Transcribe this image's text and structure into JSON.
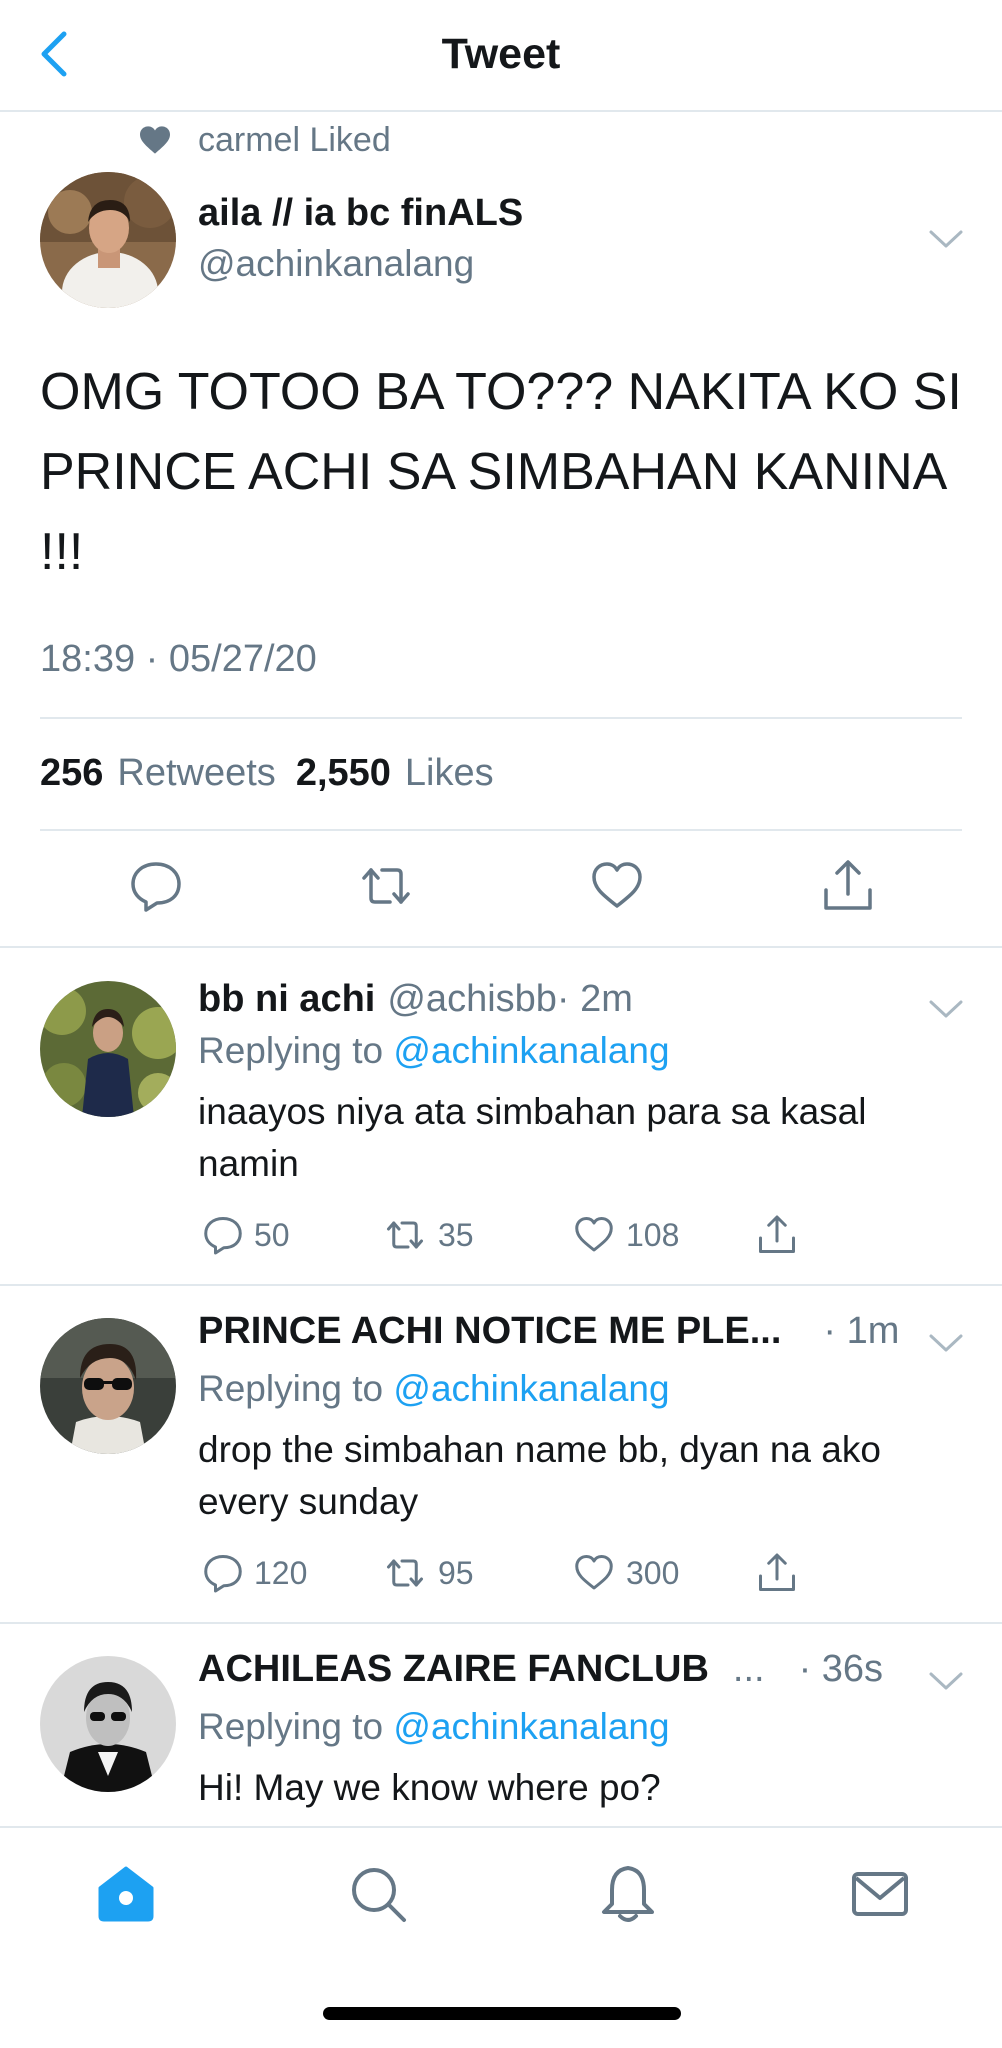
{
  "header": {
    "title": "Tweet",
    "back_icon": "chevron-left-icon"
  },
  "liked_by": {
    "text": "carmel Liked"
  },
  "tweet": {
    "author_name": "aila // ia bc finALS",
    "author_handle": "@achinkanalang",
    "text": "OMG TOTOO BA TO??? NAKITA KO SI PRINCE ACHI SA SIMBAHAN KANINA !!!",
    "timestamp": "18:39 · 05/27/20",
    "retweets_count": "256",
    "retweets_label": "Retweets",
    "likes_count": "2,550",
    "likes_label": "Likes"
  },
  "replies": [
    {
      "name": "bb ni achi",
      "handle": "@achisbb",
      "time": "· 2m",
      "replying_prefix": "Replying to",
      "replying_to": "@achinkanalang",
      "text": "inaayos niya ata simbahan para sa kasal namin",
      "reply_count": "50",
      "retweet_count": "35",
      "like_count": "108"
    },
    {
      "name": "PRINCE ACHI NOTICE ME PLE...",
      "handle": "",
      "time": "· 1m",
      "replying_prefix": "Replying to",
      "replying_to": "@achinkanalang",
      "text": "drop the simbahan name bb, dyan na ako every sunday",
      "reply_count": "120",
      "retweet_count": "95",
      "like_count": "300"
    },
    {
      "name": "ACHILEAS ZAIRE FANCLUB",
      "handle": "...",
      "time": "· 36s",
      "replying_prefix": "Replying to",
      "replying_to": "@achinkanalang",
      "text": "Hi! May we know where po?"
    }
  ],
  "tabbar": {
    "items": [
      "home-icon",
      "search-icon",
      "bell-icon",
      "mail-icon"
    ],
    "active": "home-icon"
  },
  "colors": {
    "accent": "#1da1f2",
    "text": "#14171a",
    "muted": "#657786",
    "divider": "#e1e8ed"
  }
}
